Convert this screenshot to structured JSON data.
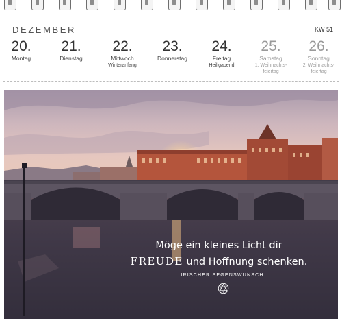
{
  "header": {
    "month": "DEZEMBER",
    "week": "KW 51"
  },
  "days": [
    {
      "number": "20.",
      "name": "Montag",
      "note": "",
      "note2": ""
    },
    {
      "number": "21.",
      "name": "Dienstag",
      "note": "",
      "note2": ""
    },
    {
      "number": "22.",
      "name": "Mittwoch",
      "note": "Winteranfang",
      "note2": ""
    },
    {
      "number": "23.",
      "name": "Donnerstag",
      "note": "",
      "note2": ""
    },
    {
      "number": "24.",
      "name": "Freitag",
      "note": "Heiligabend",
      "note2": ""
    },
    {
      "number": "25.",
      "name": "Samstag",
      "note": "1. Weihnachts-",
      "note2": "feiertag"
    },
    {
      "number": "26.",
      "name": "Sonntag",
      "note": "2. Weihnachts-",
      "note2": "feiertag"
    }
  ],
  "quote": {
    "line1": "Möge ein kleines Licht dir",
    "emphasis": "FREUDE",
    "line2_rest": " und Hoffnung schenken.",
    "source": "IRISCHER SEGENSWUNSCH"
  },
  "colors": {
    "weekend_text": "#9a9a9a",
    "text": "#333333",
    "sky": "#d8bcb9",
    "brick": "#b4553c"
  },
  "icons": {
    "logo": "celtic-knot-icon"
  }
}
